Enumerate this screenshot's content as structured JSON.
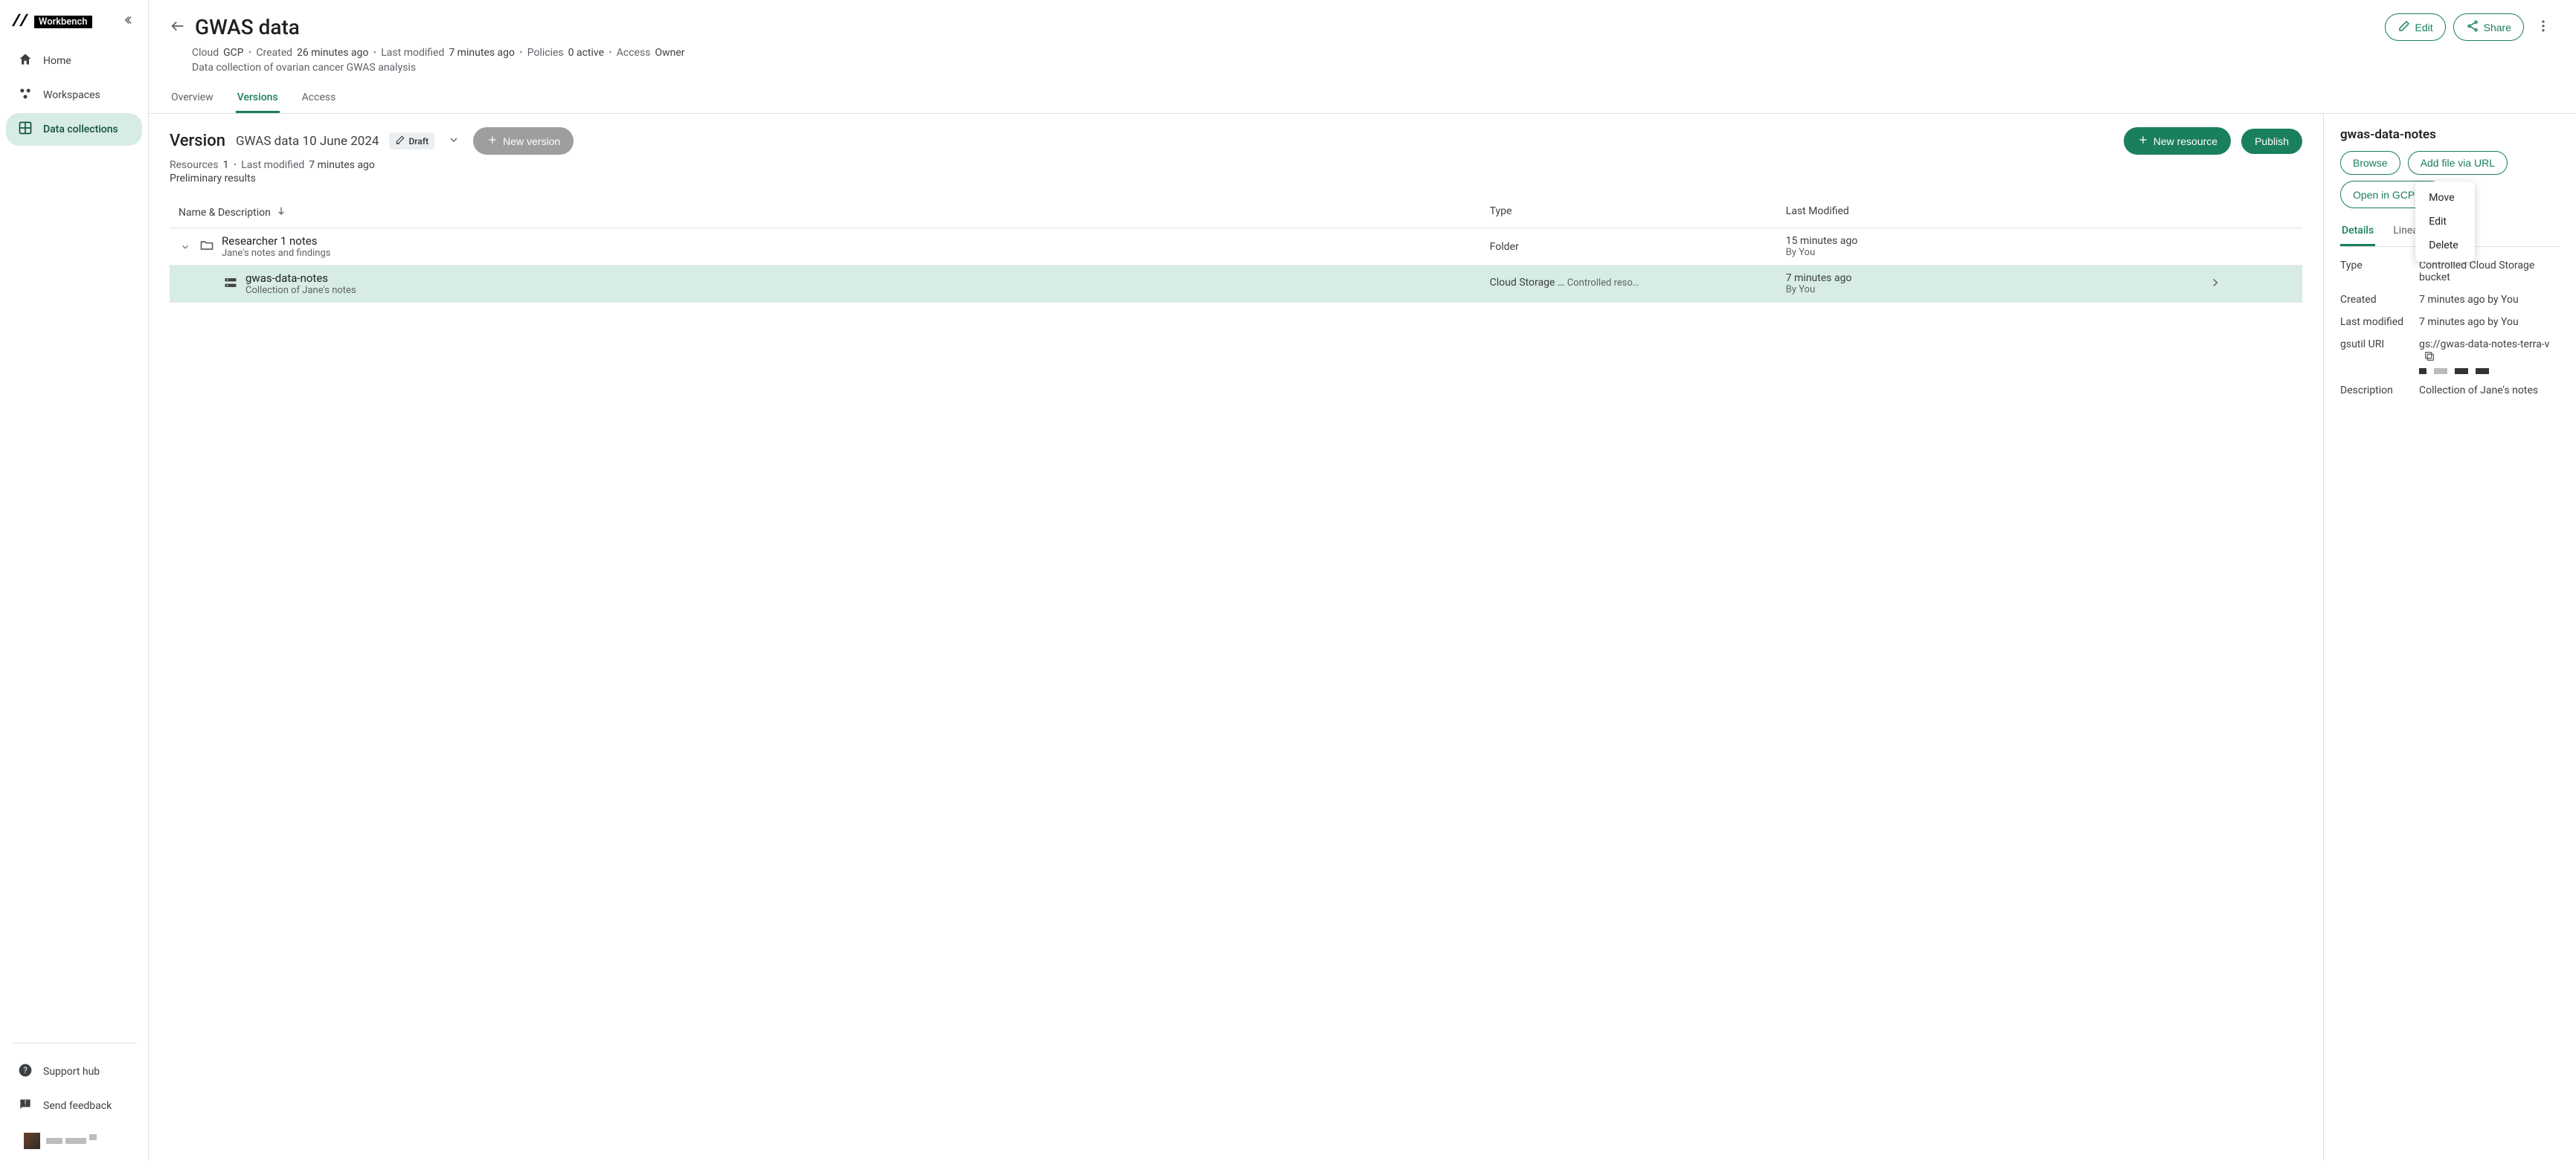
{
  "brand": {
    "name": "Workbench"
  },
  "sidebar": {
    "items": [
      {
        "label": "Home"
      },
      {
        "label": "Workspaces"
      },
      {
        "label": "Data collections"
      }
    ],
    "bottom": [
      {
        "label": "Support hub"
      },
      {
        "label": "Send feedback"
      }
    ]
  },
  "header": {
    "title": "GWAS data",
    "edit": "Edit",
    "share": "Share"
  },
  "meta": {
    "cloud_label": "Cloud",
    "cloud_value": "GCP",
    "created_label": "Created",
    "created_value": "26 minutes ago",
    "modified_label": "Last modified",
    "modified_value": "7 minutes ago",
    "policies_label": "Policies",
    "policies_value": "0 active",
    "access_label": "Access",
    "access_value": "Owner",
    "description": "Data collection of ovarian cancer GWAS analysis"
  },
  "tabs": {
    "overview": "Overview",
    "versions": "Versions",
    "access": "Access"
  },
  "version": {
    "heading": "Version",
    "name": "GWAS data 10 June 2024",
    "status": "Draft",
    "new_version": "New version",
    "new_resource": "New resource",
    "publish": "Publish",
    "resources_label": "Resources",
    "resources_count": "1",
    "last_modified_label": "Last modified",
    "last_modified_value": "7 minutes ago",
    "description": "Preliminary results"
  },
  "table": {
    "columns": {
      "name": "Name & Description",
      "type": "Type",
      "modified": "Last Modified"
    },
    "rows": [
      {
        "name": "Researcher 1 notes",
        "desc": "Jane's notes and findings",
        "type": "Folder",
        "mod_time": "15 minutes ago",
        "mod_by": "By You"
      },
      {
        "name": "gwas-data-notes",
        "desc": "Collection of Jane's notes",
        "type_l1": "Cloud Storage …",
        "type_l2": "Controlled reso…",
        "mod_time": "7 minutes ago",
        "mod_by": "By You"
      }
    ]
  },
  "panel": {
    "title": "gwas-data-notes",
    "browse": "Browse",
    "add_url": "Add file via URL",
    "open_gcp": "Open in GCP",
    "tabs": {
      "details": "Details",
      "lineage": "Lineage"
    },
    "type_label": "Type",
    "type_value": "Controlled Cloud Storage bucket",
    "created_label": "Created",
    "created_value": "7 minutes ago by You",
    "modified_label": "Last modified",
    "modified_value": "7 minutes ago by You",
    "uri_label": "gsutil URI",
    "uri_value": "gs://gwas-data-notes-terra-v",
    "desc_label": "Description",
    "desc_value": "Collection of Jane's notes"
  },
  "popup": {
    "move": "Move",
    "edit": "Edit",
    "delete": "Delete"
  }
}
